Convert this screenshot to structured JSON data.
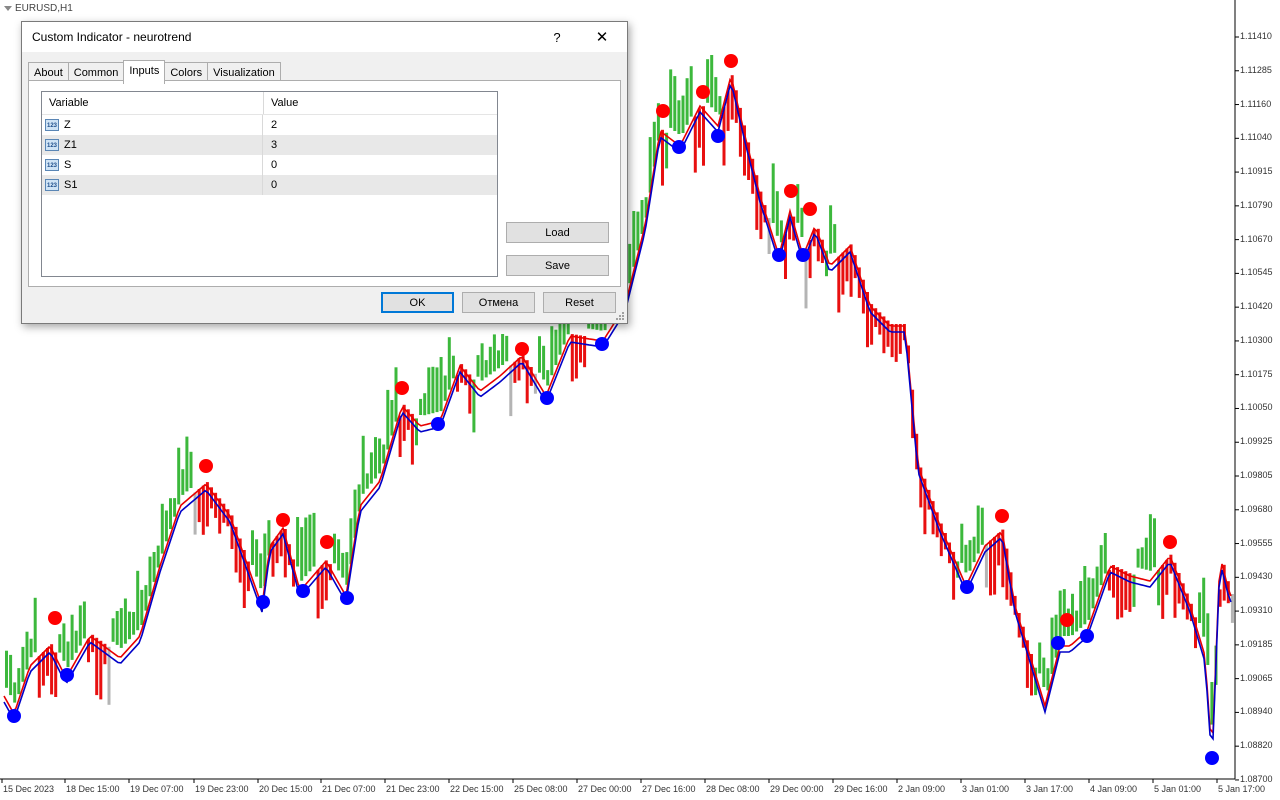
{
  "chart": {
    "symbol": "EURUSD,H1",
    "price_ticks": [
      "1.11410",
      "1.11285",
      "1.11160",
      "1.11040",
      "1.10915",
      "1.10790",
      "1.10670",
      "1.10545",
      "1.10420",
      "1.10300",
      "1.10175",
      "1.10050",
      "1.09925",
      "1.09805",
      "1.09680",
      "1.09555",
      "1.09430",
      "1.09310",
      "1.09185",
      "1.09065",
      "1.08940",
      "1.08820",
      "1.08700"
    ],
    "time_ticks": [
      "15 Dec 2023",
      "18 Dec 15:00",
      "19 Dec 07:00",
      "19 Dec 23:00",
      "20 Dec 15:00",
      "21 Dec 07:00",
      "21 Dec 23:00",
      "22 Dec 15:00",
      "25 Dec 08:00",
      "27 Dec 00:00",
      "27 Dec 16:00",
      "28 Dec 08:00",
      "29 Dec 00:00",
      "29 Dec 16:00",
      "2 Jan 09:00",
      "3 Jan 01:00",
      "3 Jan 17:00",
      "4 Jan 09:00",
      "5 Jan 01:00",
      "5 Jan 17:00"
    ],
    "colors": {
      "bull": "#3cb83c",
      "bear": "#e81010",
      "neutral": "#b4b4b4",
      "line_blue": "#0000c8",
      "line_red": "#e80000",
      "dot_red": "#ff0000",
      "dot_blue": "#0000ff"
    }
  },
  "dialog": {
    "title": "Custom Indicator - neurotrend",
    "help_label": "?",
    "close_label": "✕",
    "tabs": [
      "About",
      "Common",
      "Inputs",
      "Colors",
      "Visualization"
    ],
    "active_tab": "Inputs",
    "grid": {
      "headers": [
        "Variable",
        "Value"
      ],
      "rows": [
        {
          "icon": "123",
          "variable": "Z",
          "value": "2"
        },
        {
          "icon": "123",
          "variable": "Z1",
          "value": "3"
        },
        {
          "icon": "123",
          "variable": "S",
          "value": "0"
        },
        {
          "icon": "123",
          "variable": "S1",
          "value": "0"
        }
      ]
    },
    "load_label": "Load",
    "save_label": "Save",
    "ok_label": "OK",
    "cancel_label": "Отмена",
    "reset_label": "Reset"
  }
}
